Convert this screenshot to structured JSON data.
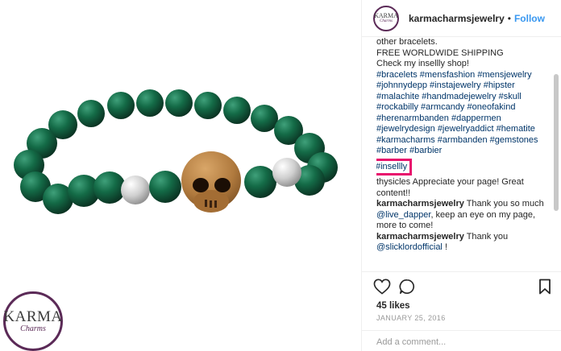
{
  "post": {
    "logo_main": "KARMA",
    "logo_sub": "Charms"
  },
  "header": {
    "avatar_main": "KARMA",
    "avatar_sub": "Charms",
    "username": "karmacharmsjewelry",
    "separator": "•",
    "follow_label": "Follow"
  },
  "caption": {
    "line_cut": "other bracelets.",
    "shipping": "FREE WORLDWIDE SHIPPING",
    "shop": "Check my insellly shop!",
    "tags": "#bracelets #mensfashion #mensjewelry #johnnydepp #instajewelry #hipster #malachite #handmadejewelry #skull #rockabilly #armcandy #oneofakind #herenarmbanden #dappermen #jewelrydesign #jewelryaddict #hematite #karmacharms #armbanden #gemstones #barber #barbier",
    "highlight_tag": "#insellly"
  },
  "comments": [
    {
      "user": "",
      "text": "thysicles Appreciate your page! Great content!!"
    },
    {
      "user": "karmacharmsjewelry",
      "text_before": " Thank you so much ",
      "mention": "@live_dapper",
      "text_after": ", keep an eye on my page, more to come!"
    },
    {
      "user": "karmacharmsjewelry",
      "text_before": " Thank you ",
      "mention": "@slicklordofficial",
      "text_after": " !"
    }
  ],
  "actions": {
    "like_icon": "heart-icon",
    "comment_icon": "comment-bubble-icon",
    "save_icon": "bookmark-icon",
    "likes": "45 likes",
    "date": "JANUARY 25, 2016",
    "add_comment_placeholder": "Add a comment..."
  },
  "colors": {
    "link": "#003569",
    "follow": "#3897f0",
    "highlight_box": "#e8106d",
    "brand": "#5b2a57"
  }
}
